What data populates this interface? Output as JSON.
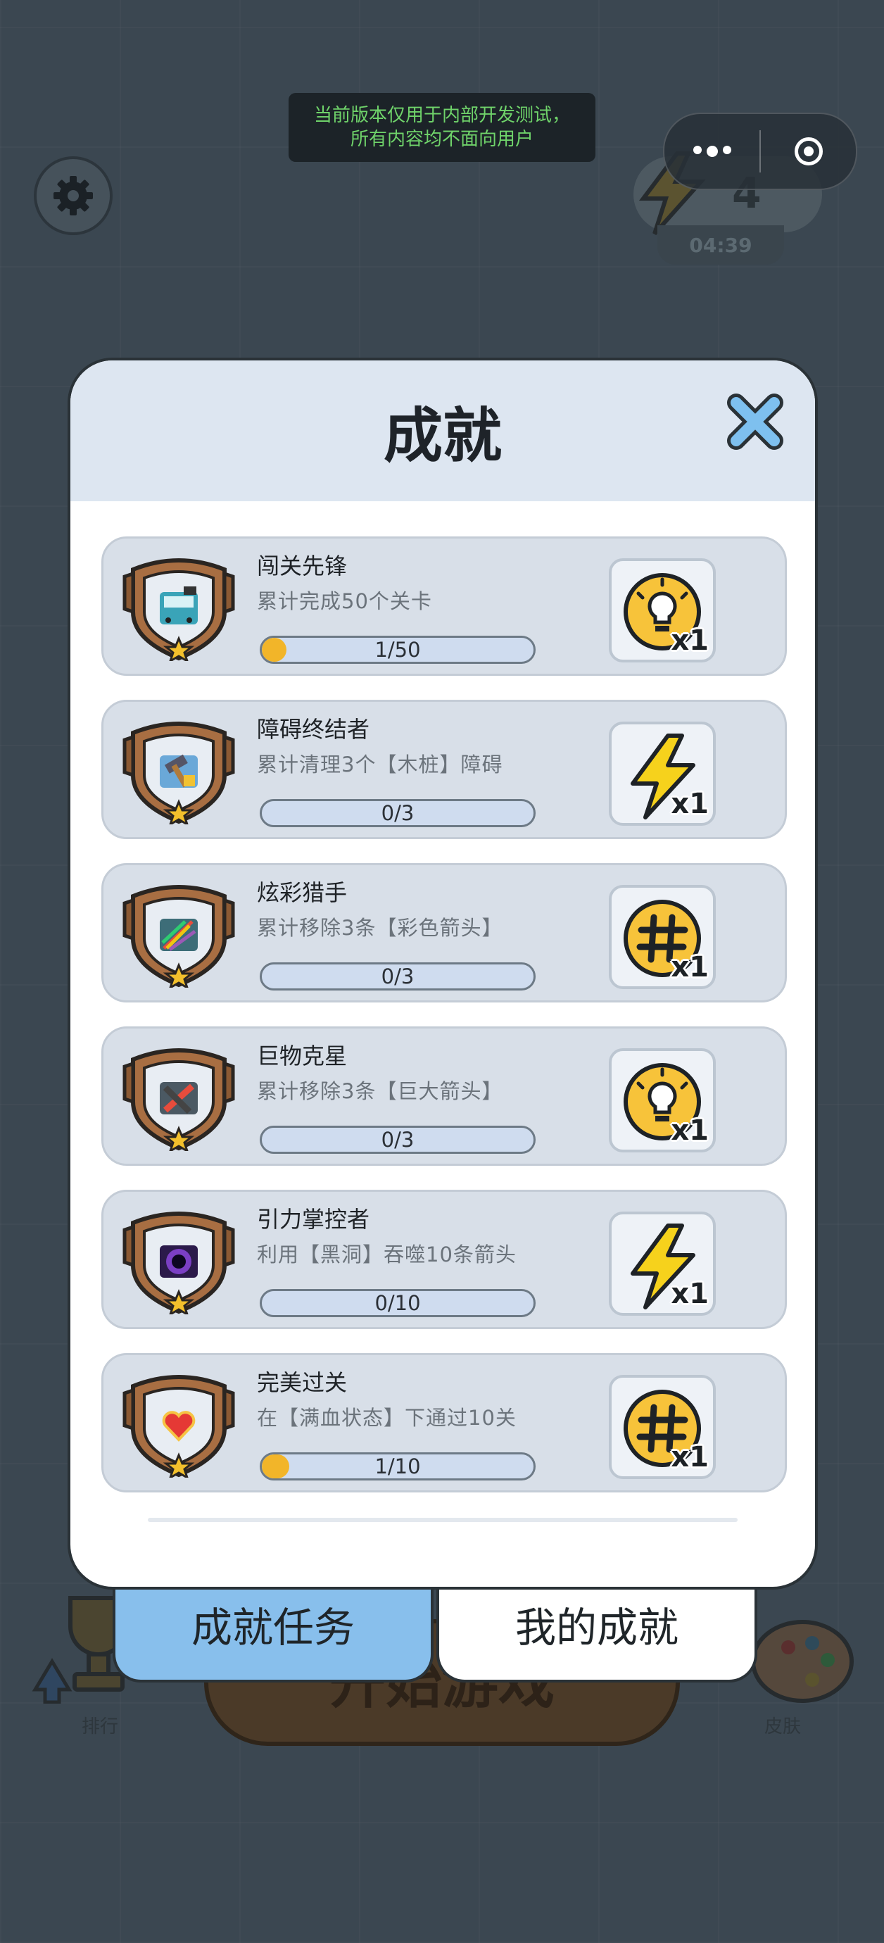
{
  "dev_banner": {
    "line1": "当前版本仅用于内部开发测试，",
    "line2": "所有内容均不面向用户"
  },
  "energy": {
    "count": "4",
    "timer": "04:39"
  },
  "background": {
    "rank_label": "排行",
    "skin_label": "皮肤",
    "start_button": "开始游戏"
  },
  "modal": {
    "title": "成就",
    "achievements": [
      {
        "title": "闯关先锋",
        "desc": "累计完成50个关卡",
        "progress": "1/50",
        "fraction": 0.02,
        "reward_icon": "lightbulb-icon",
        "reward_qty": "x1",
        "badge_icon": "train-icon"
      },
      {
        "title": "障碍终结者",
        "desc": "累计清理3个【木桩】障碍",
        "progress": "0/3",
        "fraction": 0,
        "reward_icon": "lightning-icon",
        "reward_qty": "x1",
        "badge_icon": "hammer-icon"
      },
      {
        "title": "炫彩猎手",
        "desc": "累计移除3条【彩色箭头】",
        "progress": "0/3",
        "fraction": 0,
        "reward_icon": "hash-icon",
        "reward_qty": "x1",
        "badge_icon": "color-arrows-icon"
      },
      {
        "title": "巨物克星",
        "desc": "累计移除3条【巨大箭头】",
        "progress": "0/3",
        "fraction": 0,
        "reward_icon": "lightbulb-icon",
        "reward_qty": "x1",
        "badge_icon": "giant-arrow-icon"
      },
      {
        "title": "引力掌控者",
        "desc": "利用【黑洞】吞噬10条箭头",
        "progress": "0/10",
        "fraction": 0,
        "reward_icon": "lightning-icon",
        "reward_qty": "x1",
        "badge_icon": "black-hole-icon"
      },
      {
        "title": "完美过关",
        "desc": "在【满血状态】下通过10关",
        "progress": "1/10",
        "fraction": 0.1,
        "reward_icon": "hash-icon",
        "reward_qty": "x1",
        "badge_icon": "heart-icon"
      }
    ]
  },
  "tabs": {
    "active": "成就任务",
    "inactive": "我的成就"
  },
  "colors": {
    "accent_tab": "#88bfec",
    "progress_fill": "#f2b529",
    "banner_text": "#6fd36a"
  }
}
